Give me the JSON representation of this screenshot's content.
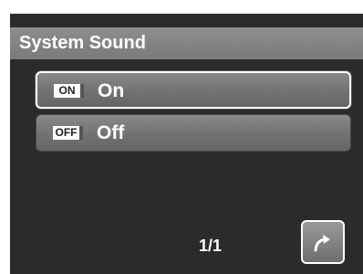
{
  "menu": {
    "title": "System Sound"
  },
  "options": [
    {
      "badge": "ON",
      "label": "On",
      "selected": true
    },
    {
      "badge": "OFF",
      "label": "Off",
      "selected": false
    }
  ],
  "footer": {
    "page_indicator": "1/1",
    "return_icon": "return-arrow-icon"
  },
  "colors": {
    "background": "#2b2b2b",
    "title_bar": "#7f7f7f",
    "option": "#747474",
    "text": "#ffffff"
  }
}
